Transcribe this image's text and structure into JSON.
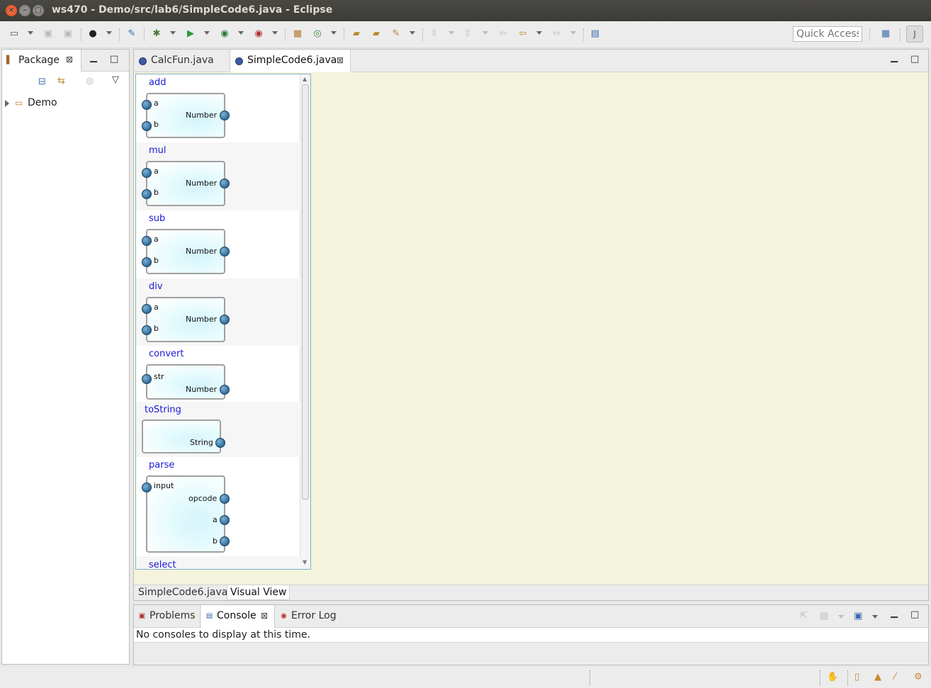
{
  "window": {
    "title": "ws470 - Demo/src/lab6/SimpleCode6.java - Eclipse",
    "close_glyph": "×",
    "min_glyph": "–",
    "max_glyph": "□"
  },
  "toolbar": {
    "quick_access_placeholder": "Quick Access"
  },
  "package_explorer": {
    "tab_label": "Package",
    "tree": [
      {
        "label": "Demo",
        "expanded": false
      }
    ]
  },
  "editor": {
    "tabs": [
      {
        "label": "CalcFun.java",
        "active": false
      },
      {
        "label": "SimpleCode6.java",
        "active": true
      }
    ],
    "bottom_tabs": [
      {
        "label": "SimpleCode6.java",
        "active": false
      },
      {
        "label": "Visual View",
        "active": true
      }
    ],
    "palette": [
      {
        "name": "add",
        "inputs": [
          "a",
          "b"
        ],
        "outputs": [
          "Number"
        ]
      },
      {
        "name": "mul",
        "inputs": [
          "a",
          "b"
        ],
        "outputs": [
          "Number"
        ]
      },
      {
        "name": "sub",
        "inputs": [
          "a",
          "b"
        ],
        "outputs": [
          "Number"
        ]
      },
      {
        "name": "div",
        "inputs": [
          "a",
          "b"
        ],
        "outputs": [
          "Number"
        ]
      },
      {
        "name": "convert",
        "inputs": [
          "str"
        ],
        "outputs": [
          "Number"
        ]
      },
      {
        "name": "toString",
        "inputs": [],
        "outputs": [
          "String"
        ]
      },
      {
        "name": "parse",
        "inputs": [
          "input"
        ],
        "outputs": [
          "opcode",
          "a",
          "b"
        ]
      },
      {
        "name": "select",
        "inputs": [],
        "outputs": []
      }
    ],
    "canvas_color": "#f4f4dc"
  },
  "bottom_panel": {
    "tabs": [
      {
        "label": "Problems",
        "active": false
      },
      {
        "label": "Console",
        "active": true
      },
      {
        "label": "Error Log",
        "active": false
      }
    ],
    "message": "No consoles to display at this time."
  },
  "colors": {
    "palette_name": "#1a1ad6",
    "port": "#2f6d9c",
    "title_bar": "#3c3b37"
  }
}
